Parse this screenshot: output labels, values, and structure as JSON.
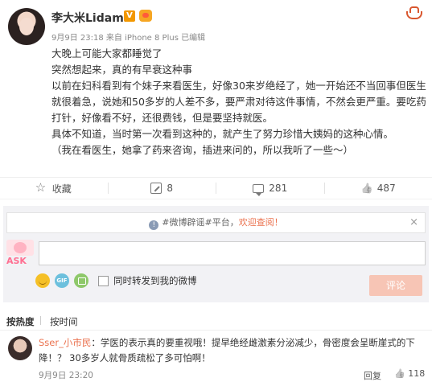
{
  "post": {
    "username": "李大米Lidami",
    "verified_badge": "V",
    "meta": "9月9日 23:18 来自 iPhone 8 Plus 已编辑",
    "lines": [
      "大晚上可能大家都睡觉了",
      "突然想起来，真的有早衰这种事",
      "以前在妇科看到有个妹子来看医生，好像30来岁绝经了，她一开始还不当回事但医生就很着急，说她和50多岁的人差不多，要严肃对待这件事情，不然会更严重。要吃药打针，好像看不好，还很费钱，但是要坚持就医。",
      "具体不知道，当时第一次看到这种的，就产生了努力珍惜大姨妈的这种心情。",
      "（我在看医生，她拿了药来咨询，插进来问的，所以我听了一些～）"
    ]
  },
  "actions": {
    "favorite": "收藏",
    "repost": "8",
    "comment": "281",
    "like": "487"
  },
  "notice": {
    "text": "#微博辟谣#平台，",
    "link": "欢迎查阅！",
    "close": "×"
  },
  "composer": {
    "ask_label": "ASK",
    "sync_label": "同时转发到我的微博",
    "submit": "评论"
  },
  "sort": {
    "hot": "按热度",
    "time": "按时间"
  },
  "comments": [
    {
      "user": "Sser_小市民",
      "text": "：学医的表示真的要重视哦！提早绝经雌激素分泌减少，骨密度会呈断崖式的下降！？ 30多岁人就骨质疏松了多可怕啊！",
      "time": "9月9日 23:20",
      "reply": "回复",
      "likes": "118"
    }
  ]
}
